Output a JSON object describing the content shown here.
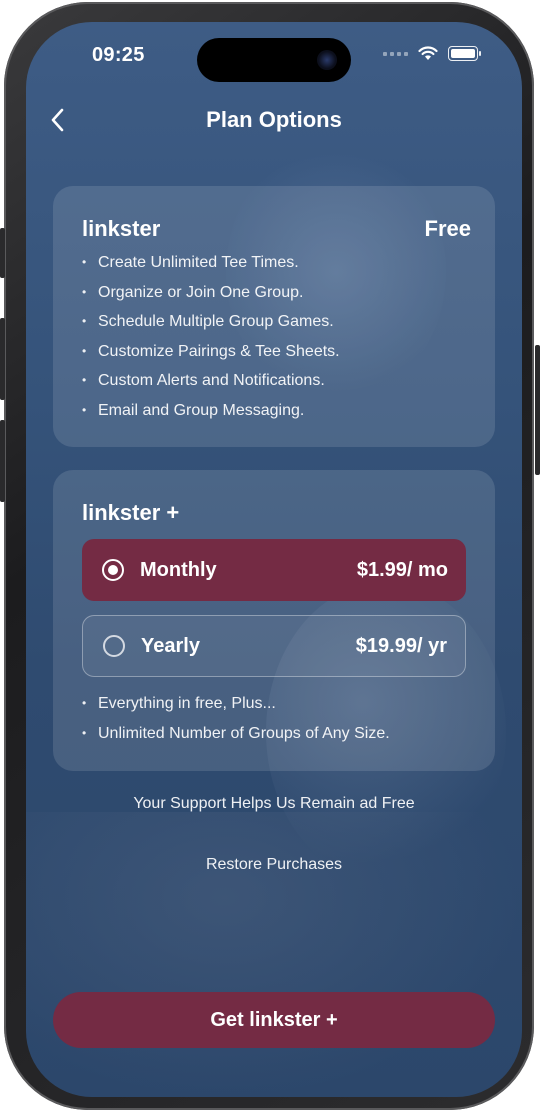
{
  "status_bar": {
    "time": "09:25",
    "icons": [
      "cellular-dots-icon",
      "wifi-icon",
      "battery-icon"
    ]
  },
  "header": {
    "title": "Plan Options",
    "back_icon": "chevron-left-icon"
  },
  "free_plan": {
    "name": "linkster",
    "price": "Free",
    "features": [
      "Create Unlimited Tee Times.",
      "Organize or Join One Group.",
      "Schedule Multiple Group Games.",
      "Customize Pairings & Tee Sheets.",
      "Custom Alerts and Notifications.",
      "Email and Group Messaging."
    ]
  },
  "plus_plan": {
    "name": "linkster +",
    "options": [
      {
        "label": "Monthly",
        "price": "$1.99/ mo",
        "selected": true
      },
      {
        "label": "Yearly",
        "price": "$19.99/ yr",
        "selected": false
      }
    ],
    "features": [
      "Everything in free, Plus...",
      "Unlimited Number of Groups of Any Size."
    ]
  },
  "support_text": "Your Support Helps Us Remain ad Free",
  "restore_label": "Restore Purchases",
  "cta_label": "Get linkster +",
  "colors": {
    "accent": "#742b44",
    "background": "#35537a"
  }
}
